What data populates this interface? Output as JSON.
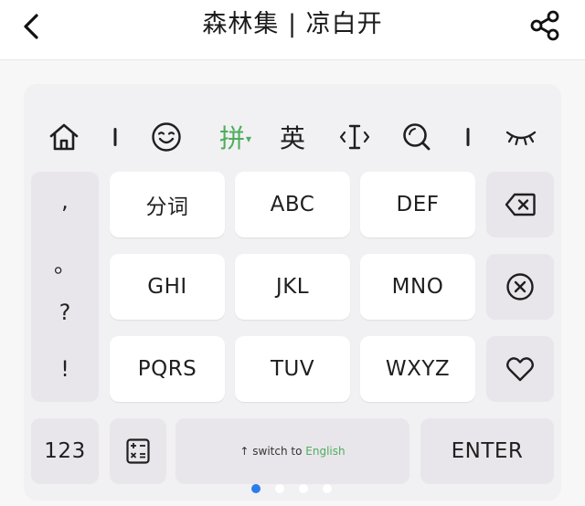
{
  "nav": {
    "title": "森林集 | 凉白开",
    "back_icon": "chevron-left-icon",
    "share_icon": "share-icon"
  },
  "toolbar": {
    "home_icon": "home-icon",
    "emoji_icon": "wink-emoji-icon",
    "pinyin_label": "拼",
    "pinyin_caret": "▾",
    "english_label": "英",
    "cursor_icon": "cursor-move-icon",
    "search_icon": "search-icon",
    "hide_icon": "closed-eye-icon",
    "accent_color": "#4cae5b"
  },
  "punctuation": [
    ",",
    "。",
    "?",
    "!"
  ],
  "keys": {
    "row1": [
      "分词",
      "ABC",
      "DEF"
    ],
    "row2": [
      "GHI",
      "JKL",
      "MNO"
    ],
    "row3": [
      "PQRS",
      "TUV",
      "WXYZ"
    ]
  },
  "side_keys": {
    "backspace_icon": "backspace-icon",
    "clear_icon": "clear-circle-icon",
    "favorite_icon": "heart-icon"
  },
  "bottom": {
    "numbers_label": "123",
    "calc_icon": "calculator-icon",
    "space_prefix": "↑ switch to",
    "space_english": "English",
    "enter_label": "ENTER"
  },
  "pager": {
    "pages": 4,
    "active": 1,
    "active_color": "#2b7de9"
  }
}
